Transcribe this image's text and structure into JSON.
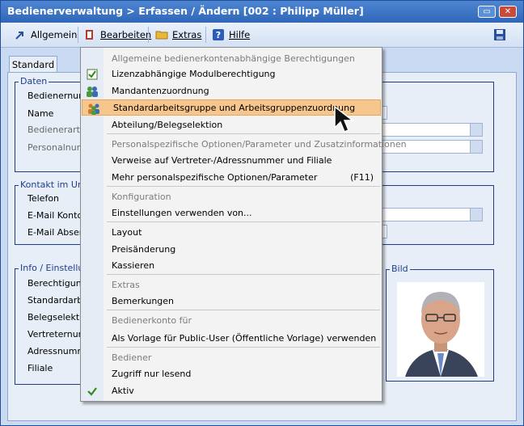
{
  "window": {
    "title": "Bedienerverwaltung > Erfassen / Ändern [002 : Philipp Müller]"
  },
  "toolbar": {
    "allgemein": "Allgemein",
    "bearbeiten": "Bearbeiten",
    "extras": "Extras",
    "hilfe": "Hilfe"
  },
  "tab": {
    "standard": "Standard"
  },
  "daten": {
    "title": "Daten",
    "labels": [
      "Bedienernumm",
      "Name",
      "Bedienerart",
      "Personalnumm"
    ]
  },
  "kontakt": {
    "title": "Kontakt im Unte",
    "labels": [
      "Telefon",
      "E-Mail Konton",
      "E-Mail Absend"
    ]
  },
  "info": {
    "title": "Info / Einstellun",
    "labels": [
      "Berechtigung",
      "Standardarbe",
      "Belegselektion",
      "Vertreternum",
      "Adressnumme",
      "Filiale"
    ]
  },
  "bild": {
    "title": "Bild"
  },
  "menu": {
    "items": [
      {
        "text": "Allgemeine bedienerkontenabhängige Berechtigungen",
        "kind": "header"
      },
      {
        "text": "Lizenzabhängige Modulberechtigung",
        "icon": "checkbox-icon"
      },
      {
        "text": "Mandantenzuordnung",
        "icon": "users-icon"
      },
      {
        "text": "Standardarbeitsgruppe und Arbeitsgruppenzuordnung",
        "icon": "group-icon",
        "highlighted": true
      },
      {
        "text": "Abteilung/Belegselektion"
      },
      {
        "text": "Personalspezifische Optionen/Parameter und Zusatzinformationen",
        "kind": "header"
      },
      {
        "text": "Verweise auf Vertreter-/Adressnummer und Filiale"
      },
      {
        "text": "Mehr personalspezifische Optionen/Parameter",
        "shortcut": "(F11)"
      },
      {
        "text": "Konfiguration",
        "kind": "header"
      },
      {
        "text": "Einstellungen verwenden von..."
      },
      {
        "text": "Layout"
      },
      {
        "text": "Preisänderung"
      },
      {
        "text": "Kassieren"
      },
      {
        "text": "Extras",
        "kind": "header"
      },
      {
        "text": "Bemerkungen"
      },
      {
        "text": "Bedienerkonto für",
        "kind": "header"
      },
      {
        "text": "Als Vorlage für Public-User (Öffentliche Vorlage) verwenden"
      },
      {
        "text": "Bediener",
        "kind": "header"
      },
      {
        "text": "Zugriff nur lesend"
      },
      {
        "text": "Aktiv",
        "icon": "check-icon"
      }
    ]
  },
  "colors": {
    "highlight": "#f7c68d",
    "titlebar": "#3a72c4",
    "group_border": "#1e3e8a"
  }
}
